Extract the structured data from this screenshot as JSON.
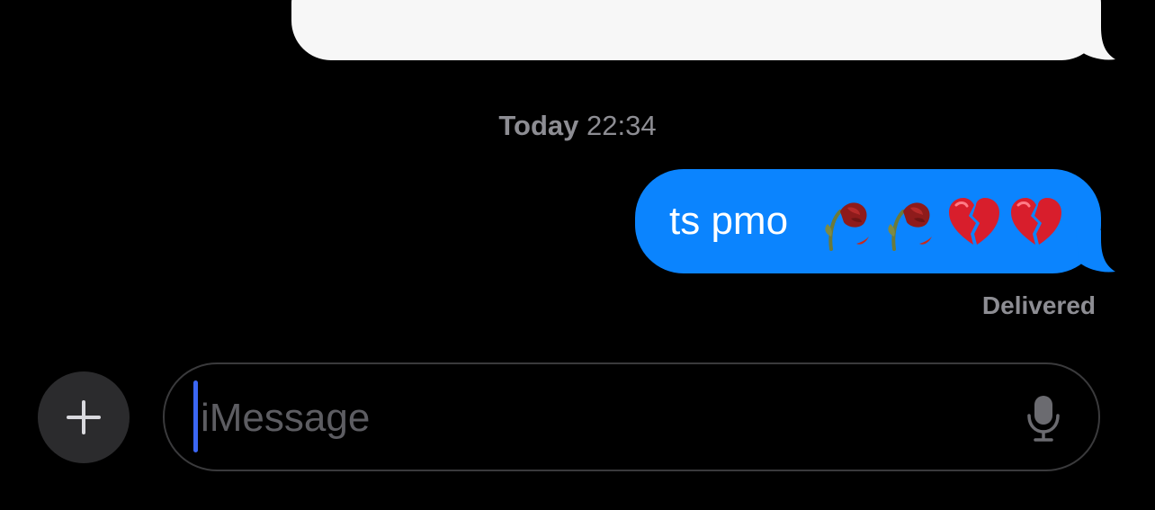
{
  "conversation": {
    "previous_message": {
      "text": ""
    },
    "timestamp": {
      "day": "Today",
      "time": "22:34"
    },
    "sent_message": {
      "text": "ts pmo",
      "emoji": [
        "wilted-flower",
        "wilted-flower",
        "broken-heart",
        "broken-heart"
      ],
      "status": "Delivered"
    }
  },
  "composer": {
    "plus_icon": "plus-icon",
    "placeholder": "iMessage",
    "mic_icon": "microphone-icon"
  },
  "colors": {
    "background": "#000000",
    "sent_bubble": "#0b84fe",
    "received_bubble": "#f7f7f7",
    "caret": "#3b67f5",
    "secondary_text": "#8d8d93"
  }
}
